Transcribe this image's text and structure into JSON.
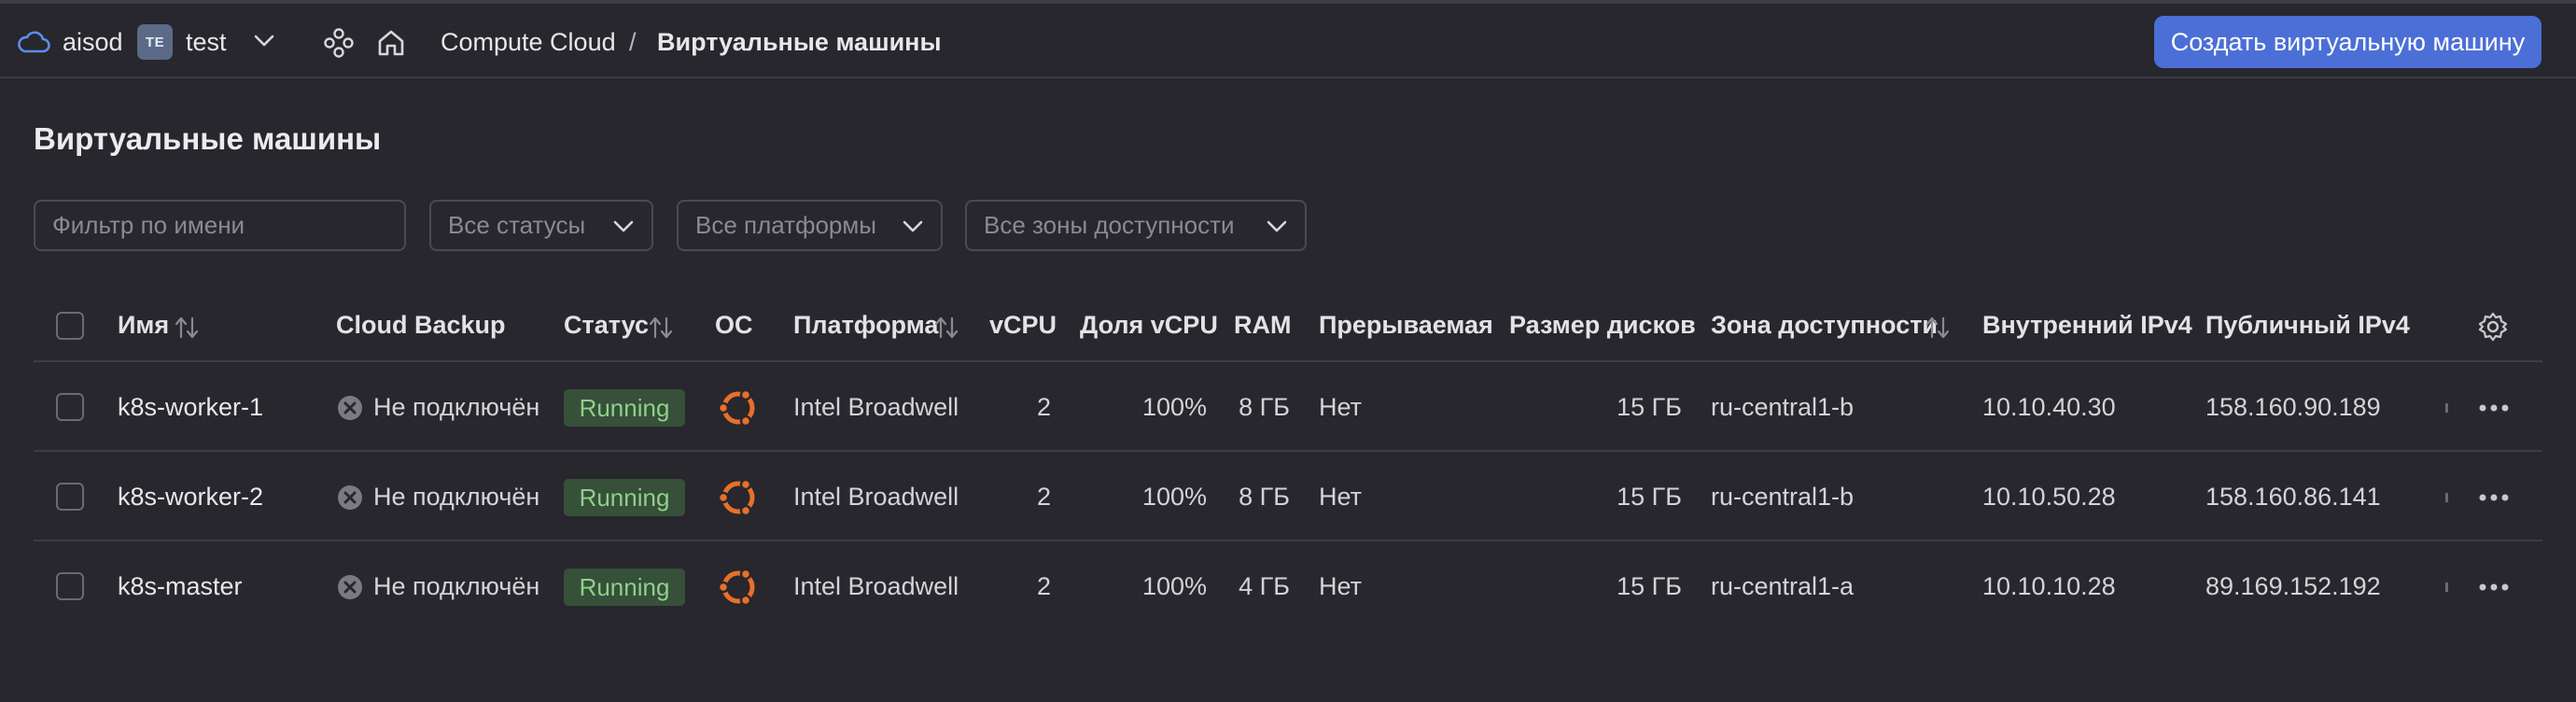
{
  "header": {
    "account": "aisod",
    "folder_badge": "TE",
    "folder_name": "test",
    "breadcrumb": {
      "service": "Compute Cloud",
      "separator": "/",
      "current": "Виртуальные машины"
    },
    "create_button": "Создать виртуальную машину"
  },
  "page": {
    "title": "Виртуальные машины"
  },
  "filters": {
    "name_placeholder": "Фильтр по имени",
    "status": "Все статусы",
    "platform": "Все платформы",
    "zone": "Все зоны доступности"
  },
  "table": {
    "columns": {
      "name": "Имя",
      "backup": "Cloud Backup",
      "status": "Статус",
      "os": "ОС",
      "platform": "Платформа",
      "vcpu": "vCPU",
      "vcpu_share": "Доля vCPU",
      "ram": "RAM",
      "preemptible": "Прерываемая",
      "disk_size": "Размер дисков",
      "zone": "Зона доступности",
      "internal_ip": "Внутренний IPv4",
      "public_ip": "Публичный IPv4"
    },
    "rows": [
      {
        "name": "k8s-worker-1",
        "backup": "Не подключён",
        "status": "Running",
        "os_icon": "ubuntu-icon",
        "platform": "Intel Broadwell",
        "vcpu": "2",
        "vcpu_share": "100%",
        "ram": "8 ГБ",
        "preemptible": "Нет",
        "disk_size": "15 ГБ",
        "zone": "ru-central1-b",
        "internal_ip": "10.10.40.30",
        "public_ip": "158.160.90.189"
      },
      {
        "name": "k8s-worker-2",
        "backup": "Не подключён",
        "status": "Running",
        "os_icon": "ubuntu-icon",
        "platform": "Intel Broadwell",
        "vcpu": "2",
        "vcpu_share": "100%",
        "ram": "8 ГБ",
        "preemptible": "Нет",
        "disk_size": "15 ГБ",
        "zone": "ru-central1-b",
        "internal_ip": "10.10.50.28",
        "public_ip": "158.160.86.141"
      },
      {
        "name": "k8s-master",
        "backup": "Не подключён",
        "status": "Running",
        "os_icon": "ubuntu-icon",
        "platform": "Intel Broadwell",
        "vcpu": "2",
        "vcpu_share": "100%",
        "ram": "4 ГБ",
        "preemptible": "Нет",
        "disk_size": "15 ГБ",
        "zone": "ru-central1-a",
        "internal_ip": "10.10.10.28",
        "public_ip": "89.169.152.192"
      }
    ]
  },
  "colors": {
    "background": "#27272d",
    "accent": "#4b6fd6",
    "status_running_bg": "#36503a",
    "status_running_text": "#8fd08a",
    "ubuntu_orange": "#e8702a"
  }
}
